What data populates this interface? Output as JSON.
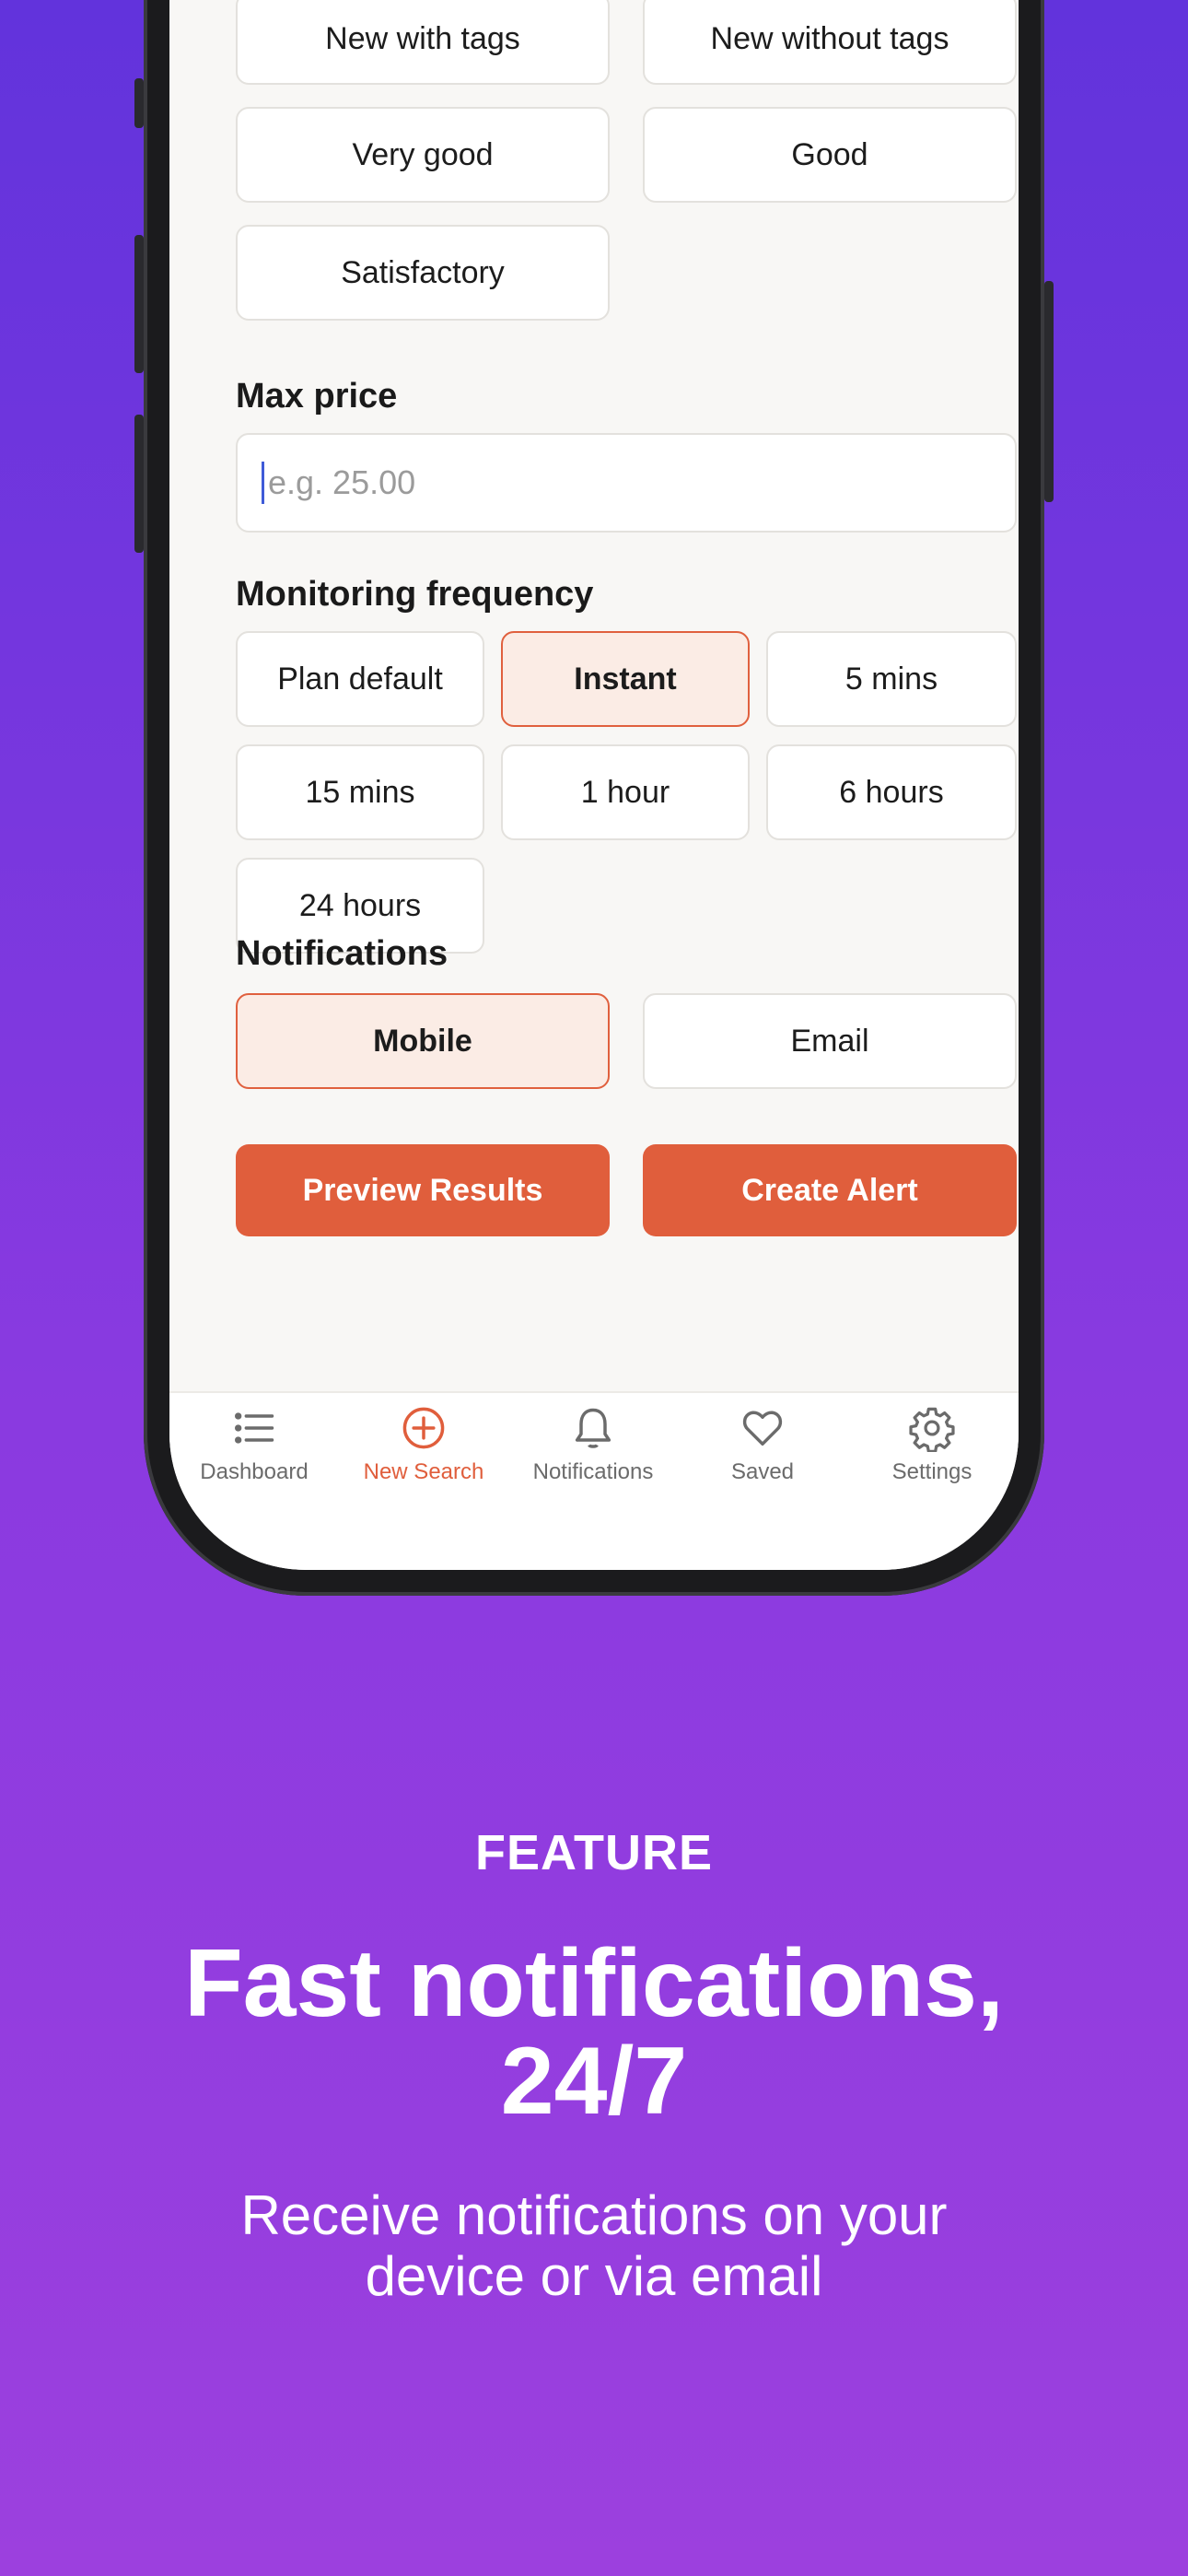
{
  "condition": {
    "options": [
      "New with tags",
      "New without tags",
      "Very good",
      "Good",
      "Satisfactory"
    ]
  },
  "max_price": {
    "label": "Max price",
    "placeholder": "e.g. 25.00",
    "value": ""
  },
  "monitoring": {
    "label": "Monitoring frequency",
    "options": [
      "Plan default",
      "Instant",
      "5 mins",
      "15 mins",
      "1 hour",
      "6 hours",
      "24 hours"
    ],
    "selected": "Instant"
  },
  "notifications": {
    "label": "Notifications",
    "options": [
      "Mobile",
      "Email"
    ],
    "selected": "Mobile"
  },
  "actions": {
    "preview": "Preview Results",
    "create": "Create Alert"
  },
  "tabbar": {
    "items": [
      {
        "label": "Dashboard",
        "icon": "list-icon"
      },
      {
        "label": "New Search",
        "icon": "plus-circle-icon"
      },
      {
        "label": "Notifications",
        "icon": "bell-icon"
      },
      {
        "label": "Saved",
        "icon": "heart-icon"
      },
      {
        "label": "Settings",
        "icon": "gear-icon"
      }
    ],
    "active": "New Search"
  },
  "marketing": {
    "eyebrow": "FEATURE",
    "headline_line1": "Fast notifications,",
    "headline_line2": "24/7",
    "sub_line1": "Receive notifications on your",
    "sub_line2": "device or via email"
  },
  "colors": {
    "accent": "#E05E3C",
    "selected_bg": "#FBECE5",
    "background_top": "#6233DC",
    "background_bottom": "#9C40DE"
  }
}
